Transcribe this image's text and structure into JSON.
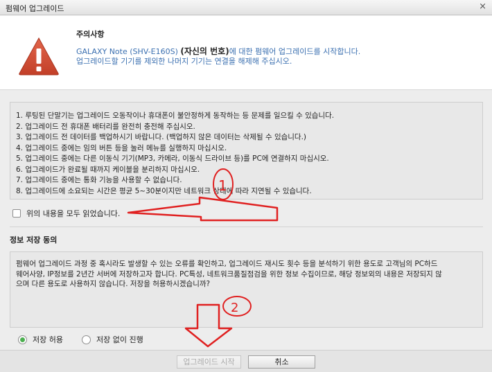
{
  "window": {
    "title": "펌웨어 업그레이드",
    "close_icon": "×"
  },
  "notice": {
    "title": "주의사항",
    "line1_prefix": "GALAXY Note (SHV-E160S) ",
    "line1_strong": "(자신의 번호)",
    "line1_suffix": "에 대한 펌웨어 업그레이드를 시작합니다.",
    "line2": "업그레이드할 기기를 제외한 나머지 기기는 연결을 해제해 주십시오.",
    "icon": "warning-triangle-icon",
    "icon_color": "#d9533a"
  },
  "cautions": [
    "1. 루팅된 단말기는 업그레이드 오동작이나 휴대폰이 불안정하게 동작하는 등 문제를 일으킬 수 있습니다.",
    "2. 업그레이드 전 휴대폰 배터리를 완전히 충전해 주십시오.",
    "3. 업그레이드 전 데이터를 백업하시기 바랍니다. (백업하지 않은 데이터는 삭제될 수 있습니다.)",
    "4. 업그레이드 중에는 임의 버튼 등을 눌러 메뉴를 실행하지 마십시오.",
    "5. 업그레이드 중에는 다른 이동식 기기(MP3, 카메라, 이동식 드라이브 등)를 PC에 연결하지 마십시오.",
    "6. 업그레이드가 완료될 때까지 케이블을 분리하지 마십시오.",
    "7. 업그레이드 중에는 통화 기능을 사용할 수 없습니다.",
    "8. 업그레이드에 소요되는 시간은 평균 5~30분이지만 네트워크 상태에 따라 지연될 수 있습니다."
  ],
  "agree": {
    "label": "위의 내용을 모두 읽었습니다.",
    "checked": false
  },
  "save": {
    "title": "정보 저장 동의",
    "line1": "펌웨어 업그레이드 과정 중 혹시라도 발생할 수 있는 오류를 확인하고, 업그레이드 재시도 횟수 등을 분석하기 위한 용도로 고객님의 PC하드",
    "line2": "웨어사양, IP정보를 2년간 서버에 저장하고자 합니다. PC특성, 네트워크품질점검을 위한 정보 수집이므로, 해당 정보외의 내용은 저장되지 않",
    "line3": "으며 다른 용도로 사용하지 않습니다. 저장을 허용하시겠습니까?",
    "option_allow": "저장 허용",
    "option_deny": "저장 없이 진행",
    "selected": "allow"
  },
  "buttons": {
    "start": "업그레이드 시작",
    "cancel": "취소"
  },
  "annotations": {
    "mark1": "1",
    "mark2": "2",
    "color": "#e02020"
  }
}
